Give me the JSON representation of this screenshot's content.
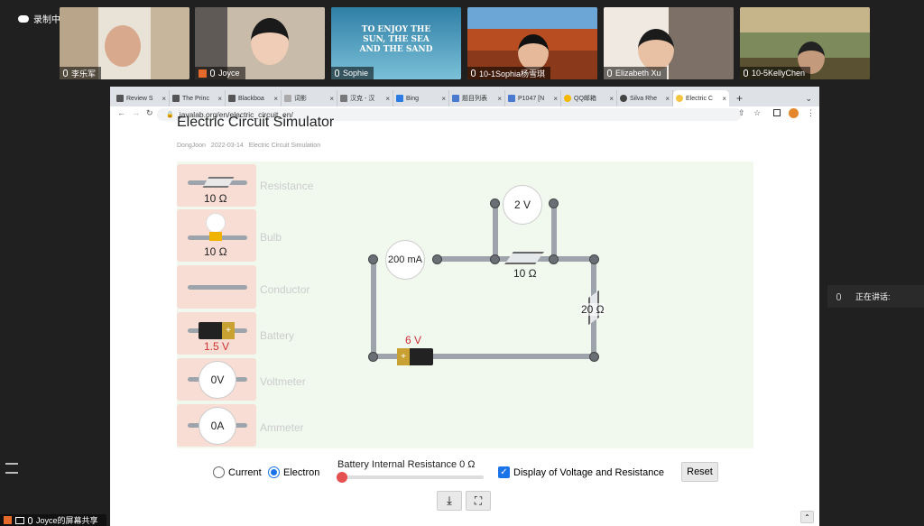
{
  "meeting": {
    "recording_label": "录制中",
    "participants": [
      {
        "name": "李乐军"
      },
      {
        "name": "Joyce"
      },
      {
        "name": "Sophie",
        "banner": "TO ENJOY THE SUN, THE SEA AND THE SAND"
      },
      {
        "name": "10-1Sophia杨雪琪"
      },
      {
        "name": "Elizabeth Xu"
      },
      {
        "name": "10-5KellyChen"
      }
    ],
    "speaking_label": "正在讲话:",
    "screen_share_label": "Joyce的屏幕共享"
  },
  "browser": {
    "tabs": [
      "Review S",
      "The Princ",
      "Blackboa",
      "词影",
      "汉克 - 汉",
      "Bing",
      "题目列表",
      "P1047 [N",
      "QQ邮箱",
      "Silva Rhe",
      "Electric C"
    ],
    "url": "javalab.org/en/electric_circuit_en/"
  },
  "page": {
    "title": "Electric Circuit Simulator",
    "author": "DongJoon",
    "date": "2022-03-14",
    "category": "Electric Circuit Simulation"
  },
  "toolbox": [
    {
      "value": "10 Ω",
      "label": "Resistance"
    },
    {
      "value": "10 Ω",
      "label": "Bulb"
    },
    {
      "value": "",
      "label": "Conductor"
    },
    {
      "value": "1.5 V",
      "label": "Battery"
    },
    {
      "value": "0V",
      "label": "Voltmeter"
    },
    {
      "value": "0A",
      "label": "Ammeter"
    }
  ],
  "circuit": {
    "voltmeter": "2 V",
    "ammeter": "200 mA",
    "resistor1": "10 Ω",
    "resistor2": "20 Ω",
    "battery": "6 V"
  },
  "controls": {
    "current_label": "Current",
    "electron_label": "Electron",
    "internal_resistance_label": "Battery Internal Resistance 0 Ω",
    "display_label": "Display of Voltage and Resistance",
    "reset_label": "Reset",
    "selected_flow": "Electron",
    "display_checked": true
  }
}
